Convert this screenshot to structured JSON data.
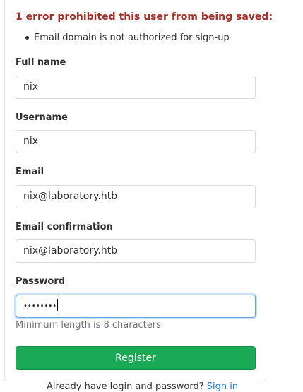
{
  "error": {
    "title": "1 error prohibited this user from being saved:",
    "items": [
      "Email domain is not authorized for sign-up"
    ]
  },
  "form": {
    "fields": [
      {
        "label": "Full name",
        "value": "nix"
      },
      {
        "label": "Username",
        "value": "nix"
      },
      {
        "label": "Email",
        "value": "nix@laboratory.htb"
      },
      {
        "label": "Email confirmation",
        "value": "nix@laboratory.htb"
      },
      {
        "label": "Password",
        "value": "••••••••"
      }
    ],
    "password_hint": "Minimum length is 8 characters",
    "submit_label": "Register"
  },
  "footer": {
    "text": "Already have login and password?",
    "link_label": "Sign in"
  },
  "colors": {
    "error_text": "#a33025",
    "register_button": "#1aaa55",
    "link": "#1f78d1",
    "focus_border": "#63a6e9"
  }
}
